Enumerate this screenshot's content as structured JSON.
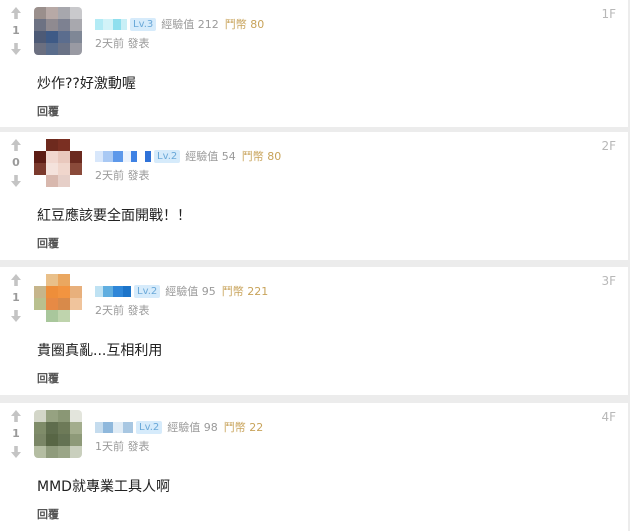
{
  "comments": [
    {
      "votes": "1",
      "level": "Lv.3",
      "exp_label": "經驗值",
      "exp_value": "212",
      "coin_label": "鬥幣",
      "coin_value": "80",
      "time": "2天前 發表",
      "floor": "1F",
      "text": "炒作??好激動喔",
      "reply": "回覆"
    },
    {
      "votes": "0",
      "level": "Lv.2",
      "exp_label": "經驗值",
      "exp_value": "54",
      "coin_label": "鬥幣",
      "coin_value": "80",
      "time": "2天前 發表",
      "floor": "2F",
      "text": "紅豆應該要全面開戰！！",
      "reply": "回覆"
    },
    {
      "votes": "1",
      "level": "Lv.2",
      "exp_label": "經驗值",
      "exp_value": "95",
      "coin_label": "鬥幣",
      "coin_value": "221",
      "time": "2天前 發表",
      "floor": "3F",
      "text": "貴圈真亂...互相利用",
      "reply": "回覆"
    },
    {
      "votes": "1",
      "level": "Lv.2",
      "exp_label": "經驗值",
      "exp_value": "98",
      "coin_label": "鬥幣",
      "coin_value": "22",
      "time": "1天前 發表",
      "floor": "4F",
      "text": "MMD就專業工具人啊",
      "reply": "回覆"
    }
  ],
  "colors": {
    "level_badge_bg": "#d6ebfb",
    "level_badge_text": "#6aa8d8",
    "coin_text": "#c8a35a",
    "card_bg": "#ffffff",
    "page_bg": "#ececec"
  },
  "icons": {
    "upvote": "arrow-up-icon",
    "downvote": "arrow-down-icon"
  }
}
